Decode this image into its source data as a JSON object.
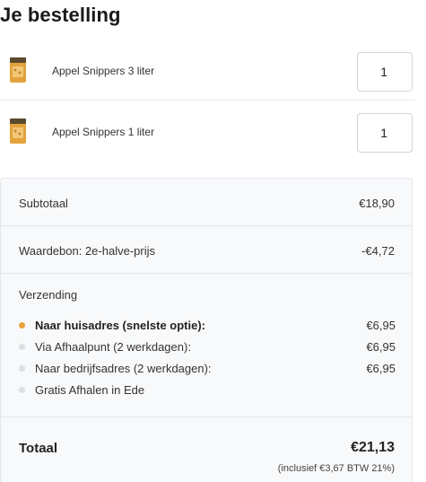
{
  "page": {
    "title": "Je bestelling"
  },
  "items": [
    {
      "name": "Appel Snippers 3 liter",
      "quantity": "1",
      "icon": "product-bag-icon"
    },
    {
      "name": "Appel Snippers 1 liter",
      "quantity": "1",
      "icon": "product-bag-icon"
    }
  ],
  "summary": {
    "subtotal_label": "Subtotaal",
    "subtotal_value": "€18,90",
    "voucher_label": "Waardebon: 2e-halve-prijs",
    "voucher_value": "-€4,72",
    "shipping_heading": "Verzending",
    "shipping_options": [
      {
        "label": "Naar huisadres (snelste optie):",
        "price": "€6,95",
        "selected": true
      },
      {
        "label": "Via Afhaalpunt (2 werkdagen):",
        "price": "€6,95",
        "selected": false
      },
      {
        "label": "Naar bedrijfsadres (2 werkdagen):",
        "price": "€6,95",
        "selected": false
      },
      {
        "label": "Gratis Afhalen in Ede",
        "price": "",
        "selected": false
      }
    ],
    "total_label": "Totaal",
    "total_value": "€21,13",
    "vat_note": "(inclusief €3,67 BTW 21%)"
  },
  "colors": {
    "selected_dot": "#e8a33d",
    "unselected_dot": "#dcdfe3",
    "panel_bg": "#f8f9fa"
  }
}
